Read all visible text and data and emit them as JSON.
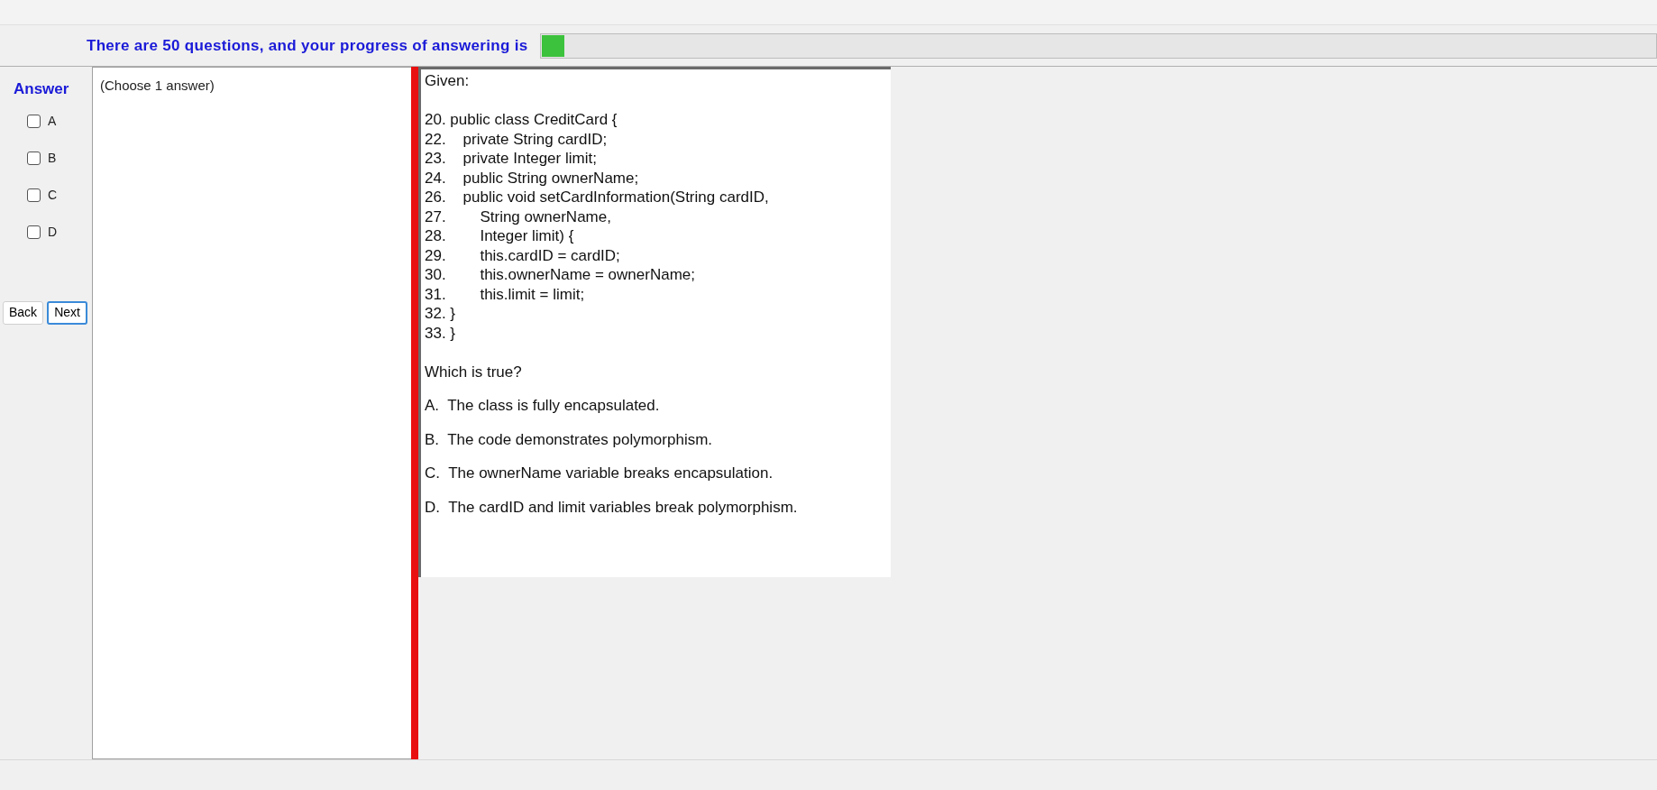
{
  "progress": {
    "label": "There are 50 questions, and your progress of answering is",
    "level": 0.02
  },
  "answer_panel": {
    "title": "Answer",
    "options": [
      {
        "label": "A",
        "checked": false
      },
      {
        "label": "B",
        "checked": false
      },
      {
        "label": "C",
        "checked": false
      },
      {
        "label": "D",
        "checked": false
      }
    ]
  },
  "buttons": [
    {
      "label": "Back",
      "focused": false
    },
    {
      "label": "Next",
      "focused": true
    }
  ],
  "instruction": "(Choose 1 answer)",
  "question": {
    "intro": "Given:",
    "code_lines": [
      "20. public class CreditCard {",
      "22.    private String cardID;",
      "23.    private Integer limit;",
      "24.    public String ownerName;",
      "26.    public void setCardInformation(String cardID,",
      "27.        String ownerName,",
      "28.        Integer limit) {",
      "29.        this.cardID = cardID;",
      "30.        this.ownerName = ownerName;",
      "31.        this.limit = limit;",
      "32. }",
      "33. }"
    ],
    "prompt": "Which is true?",
    "choices": [
      "A.  The class is fully encapsulated.",
      "B.  The code demonstrates polymorphism.",
      "C.  The ownerName variable breaks encapsulation.",
      "D.  The cardID and limit variables break polymorphism."
    ]
  }
}
